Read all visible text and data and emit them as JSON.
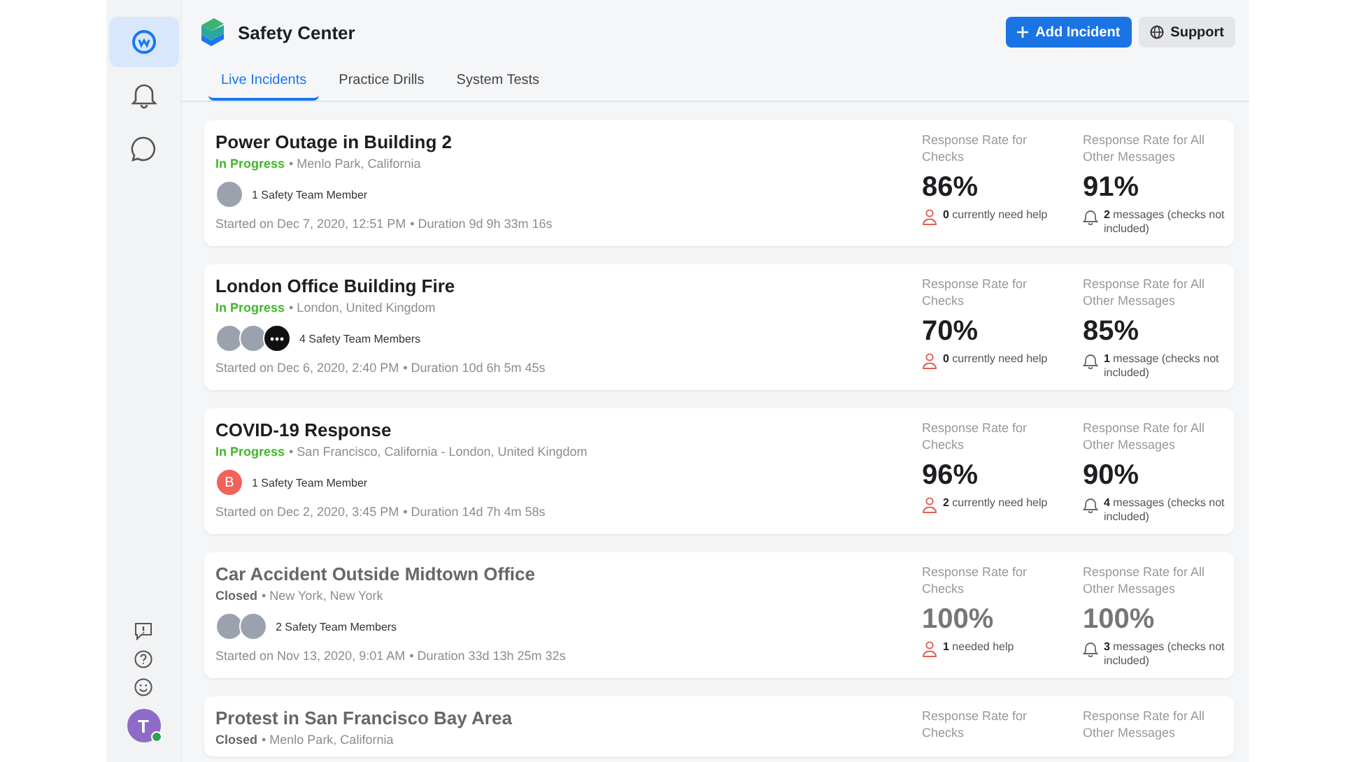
{
  "rail": {
    "top": [
      {
        "kind": "workplace",
        "selected": true
      },
      {
        "kind": "bell",
        "selected": false
      },
      {
        "kind": "chat",
        "selected": false
      }
    ],
    "bottom": [
      {
        "kind": "feedback"
      },
      {
        "kind": "help"
      },
      {
        "kind": "smiley"
      }
    ],
    "profile": {
      "initial": "T",
      "online": true
    }
  },
  "header": {
    "title": "Safety Center",
    "buttons": [
      {
        "kind": "primary",
        "label": "Add Incident"
      },
      {
        "kind": "secondary",
        "label": "Support"
      }
    ]
  },
  "tabs": [
    {
      "label": "Live Incidents",
      "selected": true
    },
    {
      "label": "Practice Drills",
      "selected": false
    },
    {
      "label": "System Tests",
      "selected": false
    }
  ],
  "incidents": [
    {
      "title": "Power Outage in Building 2",
      "closed": false,
      "status": "In Progress",
      "location": "• Menlo Park, California",
      "avatars": [
        {
          "kind": "photo"
        }
      ],
      "members": "1 Safety Team Member",
      "started": "Started on Dec 7, 2020, 12:51 PM",
      "duration": "• Duration 9d 9h 33m 16s",
      "checks_label": "Response Rate for Checks",
      "checks_rate": "86%",
      "checks_note": "**0** currently need help",
      "messages_label": "Response Rate for All Other Messages",
      "messages_rate": "91%",
      "messages_note": "**2** messages (checks not included)"
    },
    {
      "title": "London Office Building Fire",
      "closed": false,
      "status": "In Progress",
      "location": "• London, United Kingdom",
      "avatars": [
        {
          "kind": "photo"
        },
        {
          "kind": "photo"
        },
        {
          "kind": "more"
        }
      ],
      "members": "4 Safety Team Members",
      "started": "Started on Dec 6, 2020, 2:40 PM",
      "duration": "• Duration 10d 6h 5m 45s",
      "checks_label": "Response Rate for Checks",
      "checks_rate": "70%",
      "checks_note": "**0** currently need help",
      "messages_label": "Response Rate for All Other Messages",
      "messages_rate": "85%",
      "messages_note": "**1** message (checks not included)"
    },
    {
      "title": "COVID-19 Response",
      "closed": false,
      "status": "In Progress",
      "location": "• San Francisco, California - London, United Kingdom",
      "avatars": [
        {
          "kind": "letter",
          "letter": "B",
          "color": "#f0625a"
        }
      ],
      "members": "1 Safety Team Member",
      "started": "Started on Dec 2, 2020, 3:45 PM",
      "duration": "• Duration 14d 7h 4m 58s",
      "checks_label": "Response Rate for Checks",
      "checks_rate": "96%",
      "checks_note": "**2** currently need help",
      "messages_label": "Response Rate for All Other Messages",
      "messages_rate": "90%",
      "messages_note": "**4** messages (checks not included)"
    },
    {
      "title": "Car Accident Outside Midtown Office",
      "closed": true,
      "status": "Closed",
      "location": "• New York, New York",
      "avatars": [
        {
          "kind": "photo"
        },
        {
          "kind": "photo"
        }
      ],
      "members": "2 Safety Team Members",
      "started": "Started on Nov 13, 2020, 9:01 AM",
      "duration": "• Duration 33d 13h 25m 32s",
      "checks_label": "Response Rate for Checks",
      "checks_rate": "100%",
      "checks_note": "**1** needed help",
      "messages_label": "Response Rate for All Other Messages",
      "messages_rate": "100%",
      "messages_note": "**3** messages (checks not included)"
    },
    {
      "title": "Protest in San Francisco Bay Area",
      "closed": true,
      "status": "Closed",
      "location": "• Menlo Park, California",
      "checks_label": "Response Rate for Checks",
      "messages_label": "Response Rate for All Other Messages"
    }
  ]
}
